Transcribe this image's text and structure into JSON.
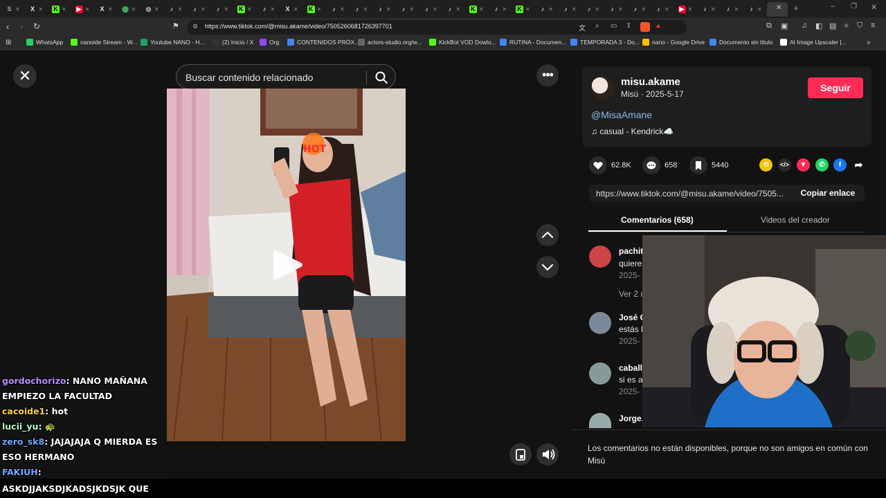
{
  "browser": {
    "tabs": [
      {
        "icon": "mute-icon",
        "label": "S"
      },
      {
        "icon": "x-icon",
        "label": "X"
      },
      {
        "icon": "kick-icon",
        "label": "K"
      },
      {
        "icon": "youtube-icon",
        "label": "▶"
      },
      {
        "icon": "x-icon",
        "label": "X"
      },
      {
        "icon": "maps-icon",
        "label": "⬤"
      },
      {
        "icon": "globe-icon",
        "label": "◍"
      },
      {
        "icon": "tiktok-icon",
        "label": "♪"
      },
      {
        "icon": "tiktok-icon",
        "label": "♪"
      },
      {
        "icon": "tiktok-icon",
        "label": "♪"
      },
      {
        "icon": "kick-icon",
        "label": "K"
      },
      {
        "icon": "tiktok-icon",
        "label": "♪"
      },
      {
        "icon": "x-icon",
        "label": "X"
      },
      {
        "icon": "kick-icon",
        "label": "K"
      },
      {
        "icon": "tiktok-icon",
        "label": "♪"
      },
      {
        "icon": "tiktok-icon",
        "label": "♪"
      },
      {
        "icon": "tiktok-icon",
        "label": "♪"
      },
      {
        "icon": "tiktok-icon",
        "label": "♪"
      },
      {
        "icon": "tiktok-icon",
        "label": "♪"
      },
      {
        "icon": "tiktok-icon",
        "label": "♪"
      },
      {
        "icon": "kick-icon",
        "label": "K"
      },
      {
        "icon": "tiktok-icon",
        "label": "♪"
      },
      {
        "icon": "kick-icon",
        "label": "K"
      },
      {
        "icon": "tiktok-icon",
        "label": "♪"
      },
      {
        "icon": "tiktok-icon",
        "label": "♪"
      },
      {
        "icon": "tiktok-icon",
        "label": "♪"
      },
      {
        "icon": "tiktok-icon",
        "label": "♪"
      },
      {
        "icon": "tiktok-icon",
        "label": "♪"
      },
      {
        "icon": "tiktok-icon",
        "label": "♪"
      },
      {
        "icon": "youtube-icon",
        "label": "▶"
      },
      {
        "icon": "tiktok-icon",
        "label": "♪"
      },
      {
        "icon": "tiktok-icon",
        "label": "♪"
      },
      {
        "icon": "tiktok-icon",
        "label": "♪"
      }
    ],
    "url": "https://www.tiktok.com/@misu.akame/video/7505260681726397701",
    "bookmarks": [
      {
        "label": "WhatsApp",
        "icon": "whatsapp-icon",
        "color": "#25d366"
      },
      {
        "label": "nanoide Stream - W...",
        "icon": "kick-icon",
        "color": "#53fc18"
      },
      {
        "label": "Youtube NANO - H...",
        "icon": "sheets-icon",
        "color": "#1fa463"
      },
      {
        "label": "(2) Inicio / X",
        "icon": "x-icon",
        "color": "#333333"
      },
      {
        "label": "Org",
        "icon": "twitch-icon",
        "color": "#9146ff"
      },
      {
        "label": "CONTENIDOS PRÓX...",
        "icon": "docs-icon",
        "color": "#4285f4"
      },
      {
        "label": "actors-studio.org/w...",
        "icon": "globe-icon",
        "color": "#666666"
      },
      {
        "label": "KickBot VOD Dowlo...",
        "icon": "kick-icon",
        "color": "#53fc18"
      },
      {
        "label": "RUTINA - Documen...",
        "icon": "docs-icon",
        "color": "#4285f4"
      },
      {
        "label": "TEMPORADA 3 - Do...",
        "icon": "docs-icon",
        "color": "#4285f4"
      },
      {
        "label": "nano - Google Drive",
        "icon": "drive-icon",
        "color": "#fbbc04"
      },
      {
        "label": "Documento sin título",
        "icon": "docs-icon",
        "color": "#4285f4"
      },
      {
        "label": "AI Image Upscaler |...",
        "icon": "ai-icon",
        "color": "#ffffff"
      }
    ]
  },
  "player": {
    "search_placeholder": "Buscar contenido relacionado",
    "close_label": "✕",
    "more_label": "•••"
  },
  "author": {
    "username": "misu.akame",
    "subtitle": "Misú · 2025-5-17",
    "follow_label": "Seguir",
    "mention": "@MisaAmane",
    "music": "♫  casual - Kendrick☁️"
  },
  "stats": {
    "likes": "62.8K",
    "comments": "658",
    "saves": "5440"
  },
  "link": {
    "url": "https://www.tiktok.com/@misu.akame/video/7505...",
    "copy_label": "Copiar enlace"
  },
  "panel_tabs": {
    "comments": "Comentarios (658)",
    "creator_videos": "Videos del creador"
  },
  "comments": [
    {
      "name": "pachit",
      "text": "quiere",
      "date": "2025-",
      "extra": "Ver 2 r",
      "avatar_color": "#c44"
    },
    {
      "name": "José C",
      "text": "estás l",
      "date": "2025-",
      "avatar_color": "#7a8899"
    },
    {
      "name": "caball",
      "text": "si es a",
      "date": "2025-",
      "avatar_color": "#889999"
    },
    {
      "name": "Jorge.",
      "text": "",
      "date": "",
      "avatar_color": "#9aa"
    }
  ],
  "comments_footer": "Los comentarios no están disponibles, porque no son amigos en común con Misú",
  "chat": [
    {
      "user": "gordochorizo",
      "color": "#b88cff",
      "msg": "NANO MAÑANA EMPIEZO LA FACULTAD"
    },
    {
      "user": "cacoide1",
      "color": "#ffd24a",
      "msg": "hot"
    },
    {
      "user": "lucii_yu",
      "color": "#b8ffcc",
      "msg": "🐢"
    },
    {
      "user": "zero_sk8",
      "color": "#6ea8ff",
      "msg": "JAJAJAJA Q MIERDA ES ESO HERMANO"
    },
    {
      "user": "FAKIUH",
      "color": "#6ea8ff",
      "msg": ""
    }
  ],
  "bottom_text": "ASKDJJAKSDJKADSJKDSJK QUE"
}
